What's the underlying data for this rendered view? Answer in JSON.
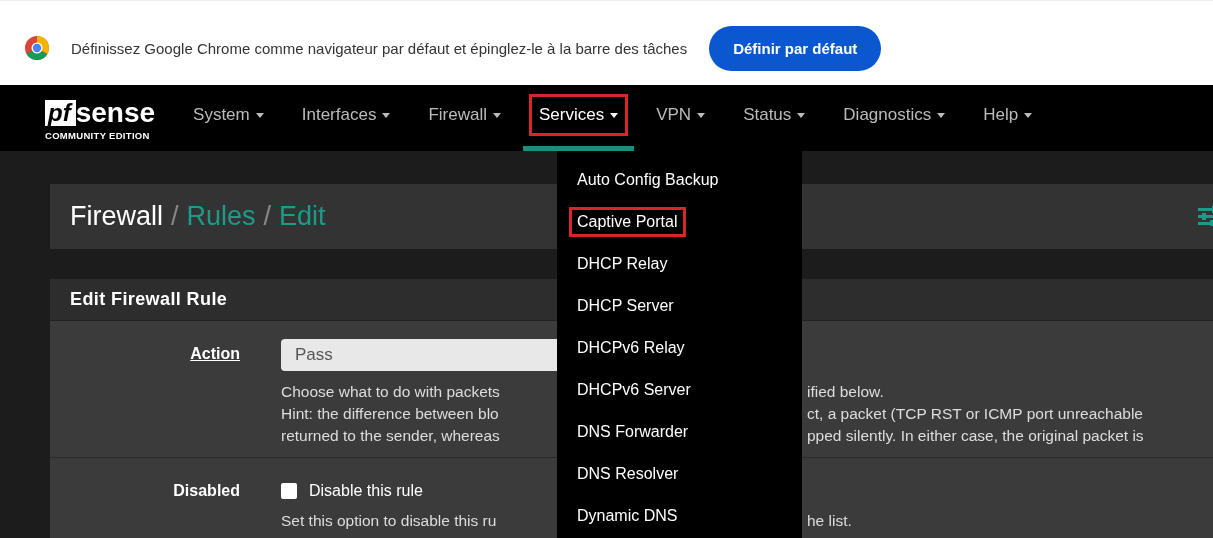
{
  "banner": {
    "message": "Définissez Google Chrome comme navigateur par défaut et épinglez-le à la barre des tâches",
    "button": "Définir par défaut"
  },
  "logo": {
    "mark": "pf",
    "name": "sense",
    "edition": "COMMUNITY EDITION"
  },
  "nav": [
    {
      "label": "System",
      "selected": false,
      "marked": false
    },
    {
      "label": "Interfaces",
      "selected": false,
      "marked": false
    },
    {
      "label": "Firewall",
      "selected": false,
      "marked": false
    },
    {
      "label": "Services",
      "selected": true,
      "marked": true
    },
    {
      "label": "VPN",
      "selected": false,
      "marked": false
    },
    {
      "label": "Status",
      "selected": false,
      "marked": false
    },
    {
      "label": "Diagnostics",
      "selected": false,
      "marked": false
    },
    {
      "label": "Help",
      "selected": false,
      "marked": false
    }
  ],
  "services_menu": [
    {
      "label": "Auto Config Backup",
      "marked": false
    },
    {
      "label": "Captive Portal",
      "marked": true
    },
    {
      "label": "DHCP Relay",
      "marked": false
    },
    {
      "label": "DHCP Server",
      "marked": false
    },
    {
      "label": "DHCPv6 Relay",
      "marked": false
    },
    {
      "label": "DHCPv6 Server",
      "marked": false
    },
    {
      "label": "DNS Forwarder",
      "marked": false
    },
    {
      "label": "DNS Resolver",
      "marked": false
    },
    {
      "label": "Dynamic DNS",
      "marked": false
    }
  ],
  "breadcrumb": [
    {
      "label": "Firewall",
      "link": false
    },
    {
      "separator": "/",
      "label": "Rules",
      "link": true
    },
    {
      "separator": "/",
      "label": "Edit",
      "link": true
    }
  ],
  "panel": {
    "title": "Edit Firewall Rule",
    "rows": [
      {
        "kind": "select",
        "label": "Action",
        "value": "Pass",
        "help": [
          [
            "Choose what to do with packets",
            "ified below."
          ],
          [
            "Hint: the difference between blo",
            "ct, a packet (TCP RST or ICMP port unreachable"
          ],
          [
            "returned to the sender, whereas",
            "pped silently. In either case, the original packet is"
          ]
        ]
      },
      {
        "kind": "checkbox",
        "label": "Disabled",
        "text": "Disable this rule",
        "checked": false,
        "help": [
          [
            "Set this option to disable this ru",
            "he list."
          ]
        ]
      }
    ]
  }
}
